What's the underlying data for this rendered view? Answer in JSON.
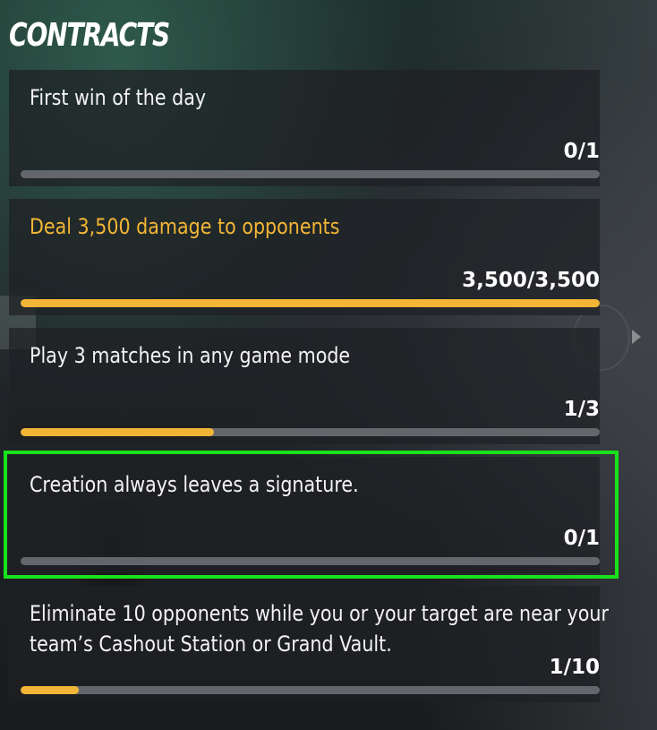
{
  "header": {
    "title": "CONTRACTS"
  },
  "contracts": [
    {
      "text": "First win of the day",
      "count": "0/1",
      "progress": 0,
      "status": "in-progress"
    },
    {
      "text": "Deal 3,500 damage to opponents",
      "count": "3,500/3,500",
      "progress": 1.0,
      "status": "completed"
    },
    {
      "text": "Play 3 matches in any game mode",
      "count": "1/3",
      "progress": 0.3333,
      "status": "in-progress"
    },
    {
      "text": "Creation always leaves a signature.",
      "count": "0/1",
      "progress": 0,
      "status": "in-progress"
    },
    {
      "text": "Eliminate 10 opponents while you or your target are near your team’s Cashout Station or Grand Vault.",
      "count": "1/10",
      "progress": 0.1,
      "status": "in-progress"
    }
  ],
  "colors": {
    "accent": "#f2b535",
    "highlight": "#19e21c",
    "track": "#63666b"
  },
  "icons": {
    "next": "chevron-right-icon"
  }
}
